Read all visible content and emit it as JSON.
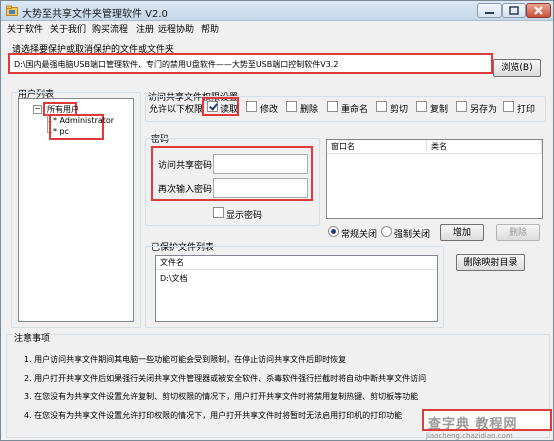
{
  "window": {
    "title": "大势至共享文件夹管理软件 V2.0"
  },
  "menu": [
    "关于软件",
    "关于我们",
    "购买流程",
    "注册",
    "远程协助",
    "帮助"
  ],
  "path_section": {
    "label": "请选择要保护或取消保护的文件或文件夹",
    "value": "D:\\国内最强电脑USB端口管理软件、专门的禁用U盘软件——大势至USB端口控制软件V3.2",
    "browse_label": "浏览(B)"
  },
  "user_list": {
    "label": "用户列表",
    "root": "所有用户",
    "users": [
      "Administrator",
      "pc"
    ]
  },
  "permissions": {
    "label": "访问共享文件权限设置",
    "allow_label": "允许以下权限",
    "options": [
      {
        "label": "读取",
        "checked": true
      },
      {
        "label": "修改",
        "checked": false
      },
      {
        "label": "删除",
        "checked": false
      },
      {
        "label": "重命名",
        "checked": false
      },
      {
        "label": "剪切",
        "checked": false
      },
      {
        "label": "复制",
        "checked": false
      },
      {
        "label": "另存为",
        "checked": false
      },
      {
        "label": "打印",
        "checked": false
      }
    ]
  },
  "password": {
    "label": "密码",
    "access_label": "访问共享密码",
    "confirm_label": "再次输入密码",
    "show_label": "显示密码",
    "show_checked": false
  },
  "window_list": {
    "col_window": "窗口名",
    "col_class": "类名"
  },
  "close_mode": {
    "normal_label": "常规关闭",
    "force_label": "强制关闭",
    "selected": "normal",
    "add_label": "增加",
    "delete_label": "删除"
  },
  "protected_list": {
    "label": "已保护文件列表",
    "col_name": "文件名",
    "items": [
      "D:\\文档"
    ],
    "delete_mapping_label": "删除映射目录"
  },
  "notes": {
    "label": "注意事项",
    "lines": [
      "1. 用户访问共享文件期间其电脑一些功能可能会受到限制，在停止访问共享文件后即时恢复",
      "2. 用户打开共享文件后如果强行关闭共享文件管理器或被安全软件、杀毒软件强行拦截时将自动中断共享文件访问",
      "3. 在您没有为共享文件设置允许复制、剪切权限的情况下，用户打开共享文件时将禁用复制热键、剪切板等功能",
      "4. 在您没有为共享文件设置允许打印权限的情况下，用户打开共享文件时将暂时无法启用打印机的打印功能"
    ]
  },
  "watermark": {
    "top": "查字典 教程网",
    "bottom": "jiaocheng.chazidian.com"
  },
  "colors": {
    "highlight": "#e03a3a",
    "watermark": "#e23b3b"
  }
}
